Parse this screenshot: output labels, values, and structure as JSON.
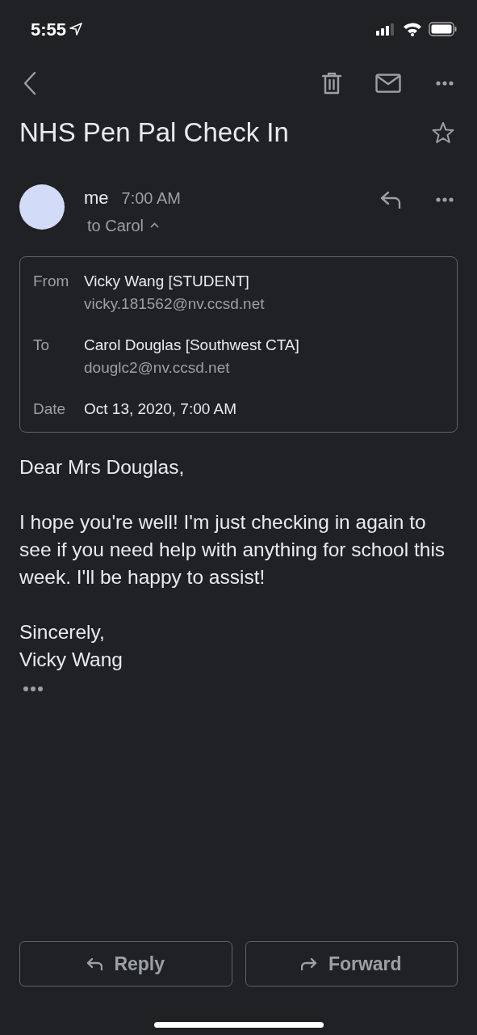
{
  "status_bar": {
    "time": "5:55"
  },
  "subject": "NHS Pen Pal Check In",
  "starred": false,
  "message": {
    "sender": "me",
    "time": "7:00 AM",
    "recipient_summary": "to Carol",
    "details_expanded": true,
    "details": [
      {
        "label": "From",
        "value": "Vicky Wang [STUDENT]",
        "email": "vicky.181562@nv.ccsd.net"
      },
      {
        "label": "To",
        "value": "Carol Douglas [Southwest CTA]",
        "email": "douglc2@nv.ccsd.net"
      },
      {
        "label": "Date",
        "value": "Oct 13, 2020, 7:00 AM"
      }
    ],
    "body": [
      "Dear Mrs Douglas,",
      "I hope you're well! I'm just checking in again to see if you need help with anything for school this week. I'll be happy to assist!",
      "Sincerely,\nVicky Wang"
    ]
  },
  "actions": [
    {
      "kind": "reply",
      "label": "Reply"
    },
    {
      "kind": "forward",
      "label": "Forward"
    }
  ]
}
